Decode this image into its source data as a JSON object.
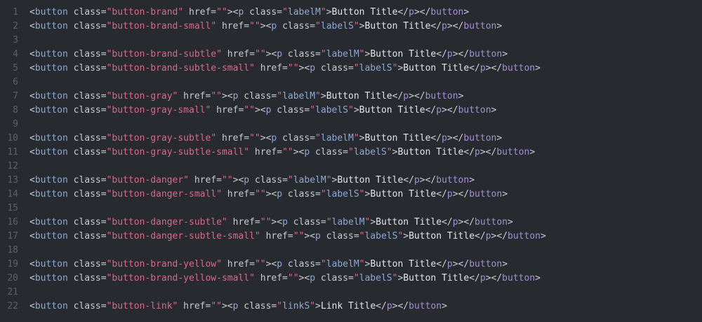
{
  "editor": {
    "lines": [
      {
        "n": "1",
        "cls": "button-brand",
        "pcls": "labelM",
        "text": "Button Title"
      },
      {
        "n": "2",
        "cls": "button-brand-small",
        "pcls": "labelS",
        "text": "Button Title"
      },
      {
        "n": "3"
      },
      {
        "n": "4",
        "cls": "button-brand-subtle",
        "pcls": "labelM",
        "text": "Button Title"
      },
      {
        "n": "5",
        "cls": "button-brand-subtle-small",
        "pcls": "labelS",
        "text": "Button Title"
      },
      {
        "n": "6"
      },
      {
        "n": "7",
        "cls": "button-gray",
        "pcls": "labelM",
        "text": "Button Title"
      },
      {
        "n": "8",
        "cls": "button-gray-small",
        "pcls": "labelS",
        "text": "Button Title"
      },
      {
        "n": "9"
      },
      {
        "n": "10",
        "cls": "button-gray-subtle",
        "pcls": "labelM",
        "text": "Button Title"
      },
      {
        "n": "11",
        "cls": "button-gray-subtle-small",
        "pcls": "labelS",
        "text": "Button Title"
      },
      {
        "n": "12"
      },
      {
        "n": "13",
        "cls": "button-danger",
        "pcls": "labelM",
        "text": "Button Title"
      },
      {
        "n": "14",
        "cls": "button-danger-small",
        "pcls": "labelS",
        "text": "Button Title"
      },
      {
        "n": "15"
      },
      {
        "n": "16",
        "cls": "button-danger-subtle",
        "pcls": "labelM",
        "text": "Button Title"
      },
      {
        "n": "17",
        "cls": "button-danger-subtle-small",
        "pcls": "labelS",
        "text": "Button Title"
      },
      {
        "n": "18"
      },
      {
        "n": "19",
        "cls": "button-brand-yellow",
        "pcls": "labelM",
        "text": "Button Title"
      },
      {
        "n": "20",
        "cls": "button-brand-yellow-small",
        "pcls": "labelS",
        "text": "Button Title"
      },
      {
        "n": "21"
      },
      {
        "n": "22",
        "cls": "button-link",
        "pcls": "linkS",
        "text": "Link Title"
      }
    ],
    "colors": {
      "background": "#272a2f",
      "gutter": "#5d6269",
      "tag": "#8fa9d6",
      "string": "#d66b8a",
      "text": "#e3e6e8",
      "close_tag": "#a58fd4"
    }
  }
}
